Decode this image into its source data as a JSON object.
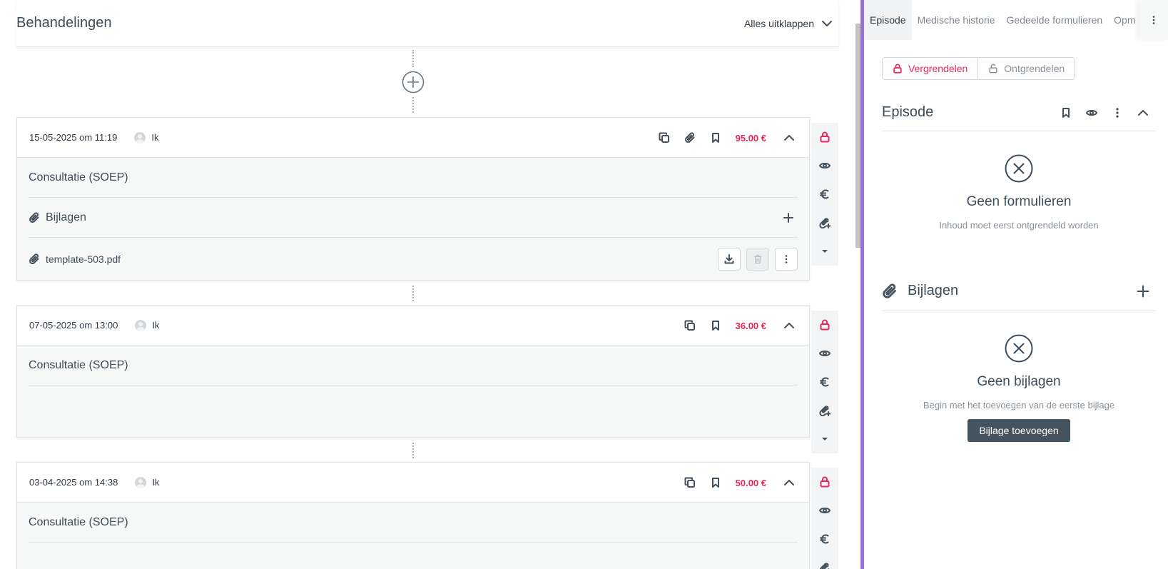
{
  "left": {
    "title": "Behandelingen",
    "expand_all": "Alles uitklappen"
  },
  "treatments": [
    {
      "date": "15-05-2025 om 11:19",
      "author": "Ik",
      "price": "95.00 €",
      "form_title": "Consultatie (SOEP)",
      "attachments_label": "Bijlagen",
      "file_name": "template-503.pdf"
    },
    {
      "date": "07-05-2025 om 13:00",
      "author": "Ik",
      "price": "36.00 €",
      "form_title": "Consultatie (SOEP)"
    },
    {
      "date": "03-04-2025 om 14:38",
      "author": "Ik",
      "price": "50.00 €",
      "form_title": "Consultatie (SOEP)"
    }
  ],
  "panel": {
    "tabs": [
      "Episode",
      "Medische historie",
      "Gedeelde formulieren",
      "Opmerkingen"
    ],
    "active_tab": "Episode",
    "lock_label": "Vergrendelen",
    "unlock_label": "Ontgrendelen",
    "episode_title": "Episode",
    "no_forms_title": "Geen formulieren",
    "no_forms_sub": "Inhoud moet eerst ontgrendeld worden",
    "attachments_title": "Bijlagen",
    "no_attachments_title": "Geen bijlagen",
    "no_attachments_sub": "Begin met het toevoegen van de eerste bijlage",
    "add_attachment_button": "Bijlage toevoegen"
  },
  "colors": {
    "accent_red": "#e8285b",
    "divider_purple": "#9b6fd0",
    "dark_button": "#45535f"
  }
}
